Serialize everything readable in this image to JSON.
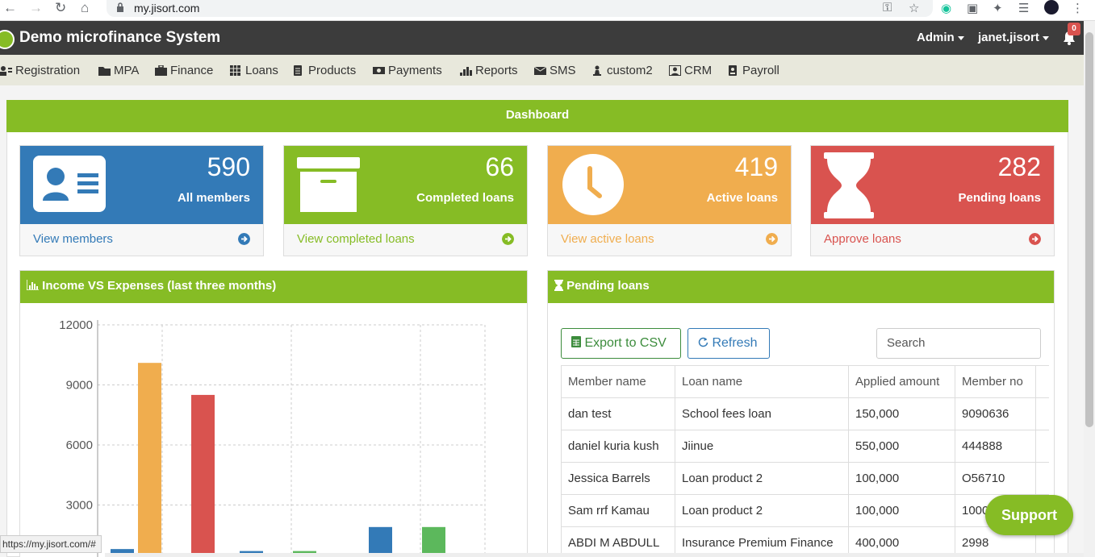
{
  "browser": {
    "url": "my.jisort.com",
    "status_url": "https://my.jisort.com/#"
  },
  "app": {
    "brand": "Demo microfinance System",
    "admin_label": "Admin",
    "username": "janet.jisort",
    "notification_count": "0"
  },
  "menu": [
    {
      "label": "Registration",
      "icon": "user-card-icon"
    },
    {
      "label": "MPA",
      "icon": "folder-icon"
    },
    {
      "label": "Finance",
      "icon": "briefcase-icon"
    },
    {
      "label": "Loans",
      "icon": "table-icon"
    },
    {
      "label": "Products",
      "icon": "document-icon"
    },
    {
      "label": "Payments",
      "icon": "money-icon"
    },
    {
      "label": "Reports",
      "icon": "bar-chart-icon"
    },
    {
      "label": "SMS",
      "icon": "envelope-icon"
    },
    {
      "label": "custom2",
      "icon": "chess-pawn-icon"
    },
    {
      "label": "CRM",
      "icon": "portrait-icon"
    },
    {
      "label": "Payroll",
      "icon": "id-badge-icon"
    }
  ],
  "dashboard": {
    "title": "Dashboard",
    "cards": [
      {
        "value": "590",
        "label": "All members",
        "link": "View members",
        "color": "#337ab7",
        "link_color": "#337ab7"
      },
      {
        "value": "66",
        "label": "Completed loans",
        "link": "View completed loans",
        "color": "#86bc25",
        "link_color": "#86bc25"
      },
      {
        "value": "419",
        "label": "Active loans",
        "link": "View active loans",
        "color": "#f0ad4e",
        "link_color": "#f0ad4e"
      },
      {
        "value": "282",
        "label": "Pending loans",
        "link": "Approve loans",
        "color": "#d9534f",
        "link_color": "#d9534f"
      }
    ]
  },
  "income_panel": {
    "title": "Income VS Expenses (last three months)"
  },
  "chart_data": {
    "type": "bar",
    "title": "Income VS Expenses (last three months)",
    "ylim": [
      0,
      12000
    ],
    "yticks": [
      "12000",
      "9000",
      "6000",
      "3000"
    ],
    "bars": [
      {
        "group": 1,
        "value": 800,
        "color": "#337ab7"
      },
      {
        "group": 1,
        "value": 10100,
        "color": "#f0ad4e"
      },
      {
        "group": 1,
        "value": 8500,
        "color": "#d9534f"
      },
      {
        "group": 2,
        "value": 700,
        "color": "#337ab7"
      },
      {
        "group": 2,
        "value": 700,
        "color": "#5cb85c"
      },
      {
        "group": 3,
        "value": 1900,
        "color": "#337ab7"
      },
      {
        "group": 3,
        "value": 1900,
        "color": "#5cb85c"
      }
    ]
  },
  "pending_panel": {
    "title": "Pending loans",
    "export_label": "Export to CSV",
    "refresh_label": "Refresh",
    "search_placeholder": "Search",
    "columns": [
      "Member name",
      "Loan name",
      "Applied amount",
      "Member no"
    ],
    "rows": [
      [
        "dan test",
        "School fees loan",
        "150,000",
        "9090636"
      ],
      [
        "daniel kuria kush",
        "Jiinue",
        "550,000",
        "444888"
      ],
      [
        "Jessica Barrels",
        "Loan product 2",
        "100,000",
        "O56710"
      ],
      [
        "Sam rrf Kamau",
        "Loan product 2",
        "100,000",
        "1000"
      ],
      [
        "ABDI M ABDULL",
        "Insurance Premium Finance",
        "400,000",
        "2998"
      ]
    ]
  },
  "support_label": "Support"
}
